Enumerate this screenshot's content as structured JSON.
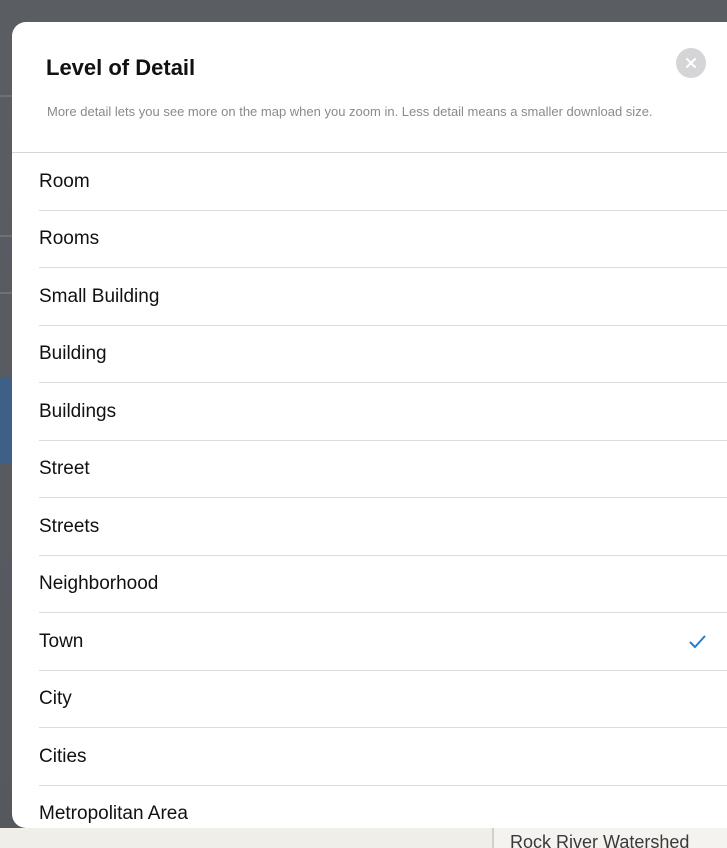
{
  "dialog": {
    "title": "Level of Detail",
    "description": "More detail lets you see more on the map when you zoom in. Less detail means a smaller download size.",
    "close_icon": "close-icon"
  },
  "options": [
    {
      "label": "Room",
      "selected": false
    },
    {
      "label": "Rooms",
      "selected": false
    },
    {
      "label": "Small Building",
      "selected": false
    },
    {
      "label": "Building",
      "selected": false
    },
    {
      "label": "Buildings",
      "selected": false
    },
    {
      "label": "Street",
      "selected": false
    },
    {
      "label": "Streets",
      "selected": false
    },
    {
      "label": "Neighborhood",
      "selected": false
    },
    {
      "label": "Town",
      "selected": true
    },
    {
      "label": "City",
      "selected": false
    },
    {
      "label": "Cities",
      "selected": false
    },
    {
      "label": "Metropolitan Area",
      "selected": false
    }
  ],
  "background": {
    "map_label": "Rock River Watershed"
  },
  "colors": {
    "accent": "#1e7fd1",
    "title": "#111111",
    "description": "#8a8a8e",
    "overlay": "#4f5358"
  }
}
